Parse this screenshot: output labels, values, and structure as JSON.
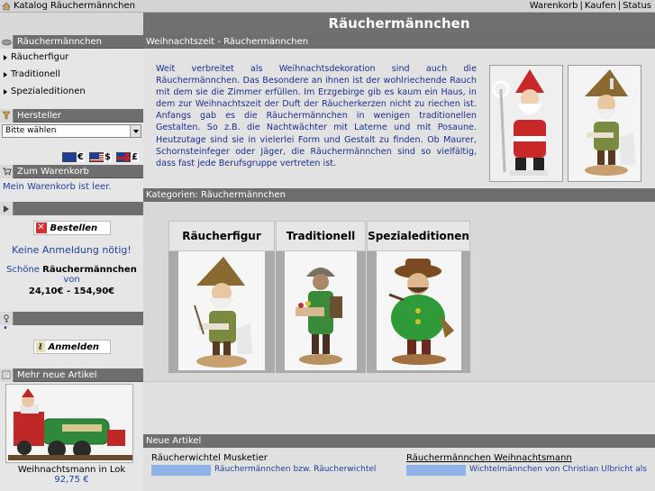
{
  "topbar": {
    "breadcrumb": "Katalog Räuchermännchen",
    "links": [
      "Warenkorb",
      "Kaufen",
      "Status"
    ]
  },
  "main_title": "Räuchermännchen",
  "sidebar": {
    "categories_header": "Räuchermännchen",
    "categories": [
      "Räucherfigur",
      "Traditionell",
      "Spezialeditionen"
    ],
    "manufacturer_header": "Hersteller",
    "manufacturer_select": "Bitte wählen",
    "currencies": [
      "€",
      "$",
      "£"
    ],
    "cart_header": "Zum Warenkorb",
    "cart_text": "Mein Warenkorb ist leer.",
    "order_button": "Bestellen",
    "login_hint": "Keine Anmeldung nötig!",
    "price_hint_prefix": "Schöne ",
    "price_hint_bold": "Räuchermännchen",
    "price_hint_suffix": " von",
    "price_range": "24,10€ - 154,90€",
    "dot": "•",
    "login_button": "Anmelden",
    "new_items_header": "Mehr neue Artikel",
    "new_item_name": "Weihnachtsmann in Lok",
    "new_item_price": "92,75 €"
  },
  "intro": {
    "header": "Weihnachtszeit - Räuchermännchen",
    "text": "Weit verbreitet als Weihnachtsdekoration sind auch die Räuchermännchen. Das Besondere an ihnen ist der wohlriechende Rauch mit dem sie die Zimmer erfüllen. Im Erzgebirge gib es kaum ein Haus, in dem zur Weihnachtszeit der Duft der Räucherkerzen nicht zu riechen ist. Anfangs gab es die Räuchermännchen in wenigen traditionellen Gestalten. So z.B. die Nachtwächter mit Laterne und mit Posaune. Heutzutage sind sie in vielerlei Form und Gestalt zu finden. Ob Maurer, Schornsteinfeger oder Jäger, die Räuchermännchen sind so vielfältig, dass fast jede Berufsgruppe vertreten ist."
  },
  "categories": {
    "header": "Kategorien: Räuchermännchen",
    "items": [
      "Räucherfigur",
      "Traditionell",
      "Spezialeditionen"
    ]
  },
  "new_items": {
    "header": "Neue Artikel",
    "items": [
      {
        "title": "Räucherwichtel Musketier",
        "desc": "Räuchermännchen bzw. Räucherwichtel"
      },
      {
        "title": "Räuchermännchen Weihnachtsmann",
        "desc": "Wichtelmännchen von Christian Ulbricht als"
      }
    ]
  },
  "colors": {
    "header_gray": "#6e6e6e",
    "title_gray": "#707070",
    "link_blue": "#2040a0"
  }
}
